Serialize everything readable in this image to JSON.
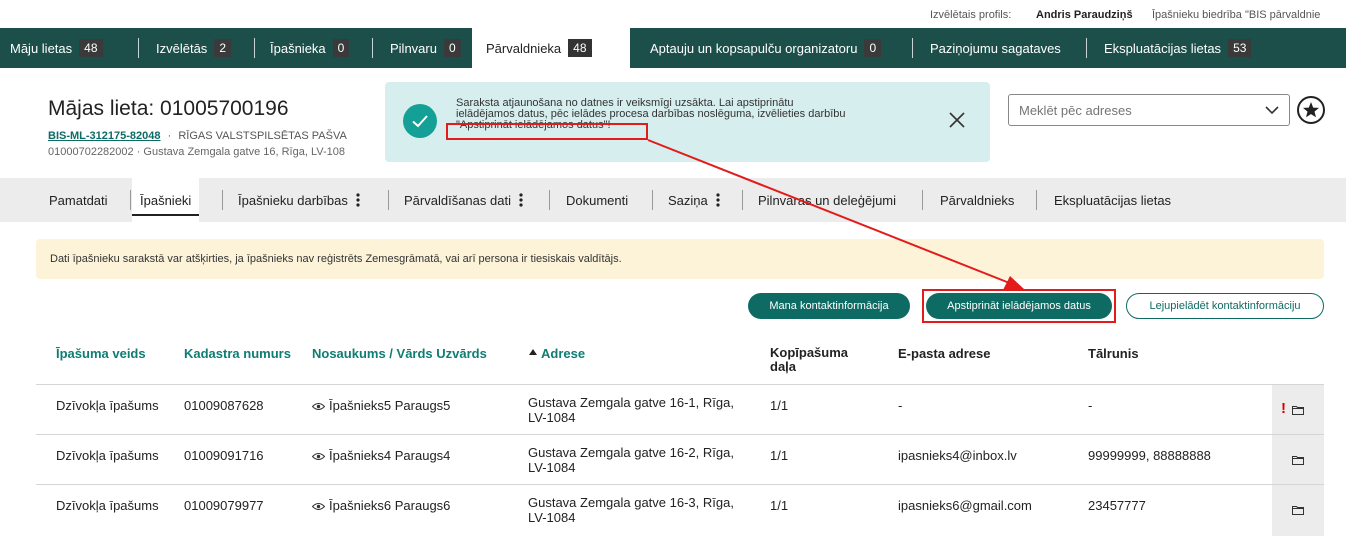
{
  "profile": {
    "label": "Izvēlētais profils:",
    "user": "Andris Paraudziņš",
    "org": "Īpašnieku biedrība \"BIS pārvaldnie"
  },
  "nav": {
    "items": [
      {
        "label": "Māju lietas",
        "count": "48"
      },
      {
        "label": "Izvēlētās",
        "count": "2"
      },
      {
        "label": "Īpašnieka",
        "count": "0"
      },
      {
        "label": "Pilnvaru",
        "count": "0"
      },
      {
        "label": "Pārvaldnieka",
        "count": "48"
      },
      {
        "label": "Aptauju un kopsapulču organizatoru",
        "count": "0"
      },
      {
        "label": "Paziņojumu sagataves",
        "count": ""
      },
      {
        "label": "Ekspluatācijas lietas",
        "count": "53"
      }
    ],
    "active_index": 4
  },
  "header": {
    "title": "Mājas lieta: 01005700196",
    "case_link": "BIS-ML-312175-82048",
    "separator": "·",
    "municipality": "RĪGAS VALSTSPILSĒTAS PAŠVA",
    "cadastre_address": "01000702282002 · Gustava Zemgala gatve 16, Rīga, LV-108"
  },
  "toast": {
    "line1": "Saraksta atjaunošana no datnes ir veiksmīgi uzsākta. Lai apstiprinātu",
    "line2": "ielādējamos datus, pēc ielādes procesa darbības noslēguma, izvēlieties darbību",
    "line3": "\"Apstiprināt ielādējamos datus\"!"
  },
  "search": {
    "placeholder": "Meklēt pēc adreses"
  },
  "tabs": [
    {
      "label": "Pamatdati",
      "menu": false
    },
    {
      "label": "Īpašnieki",
      "menu": false
    },
    {
      "label": "Īpašnieku darbības",
      "menu": true
    },
    {
      "label": "Pārvaldīšanas dati",
      "menu": true
    },
    {
      "label": "Dokumenti",
      "menu": false
    },
    {
      "label": "Saziņa",
      "menu": true
    },
    {
      "label": "Pilnvaras un deleģējumi",
      "menu": false
    },
    {
      "label": "Pārvaldnieks",
      "menu": false
    },
    {
      "label": "Ekspluatācijas lietas",
      "menu": false
    }
  ],
  "notice": "Dati īpašnieku sarakstā var atšķirties, ja īpašnieks nav reģistrēts Zemesgrāmatā, vai arī persona ir tiesiskais valdītājs.",
  "buttons": {
    "my_contacts": "Mana kontaktinformācija",
    "confirm": "Apstiprināt ielādējamos datus",
    "download": "Lejupielādēt kontaktinformāciju"
  },
  "table": {
    "headers": {
      "type": "Īpašuma veids",
      "cadastre": "Kadastra numurs",
      "name": "Nosaukums / Vārds Uzvārds",
      "sort_icon": "sort-ascending-icon",
      "address": "Adrese",
      "share_l1": "Kopīpašuma",
      "share_l2": "daļa",
      "email": "E-pasta adrese",
      "phone": "Tālrunis"
    },
    "rows": [
      {
        "type": "Dzīvokļa īpašums",
        "cadastre": "01009087628",
        "name": "Īpašnieks5 Paraugs5",
        "address_l1": "Gustava Zemgala gatve 16-1, Rīga,",
        "address_l2": "LV-1084",
        "share": "1/1",
        "email": "-",
        "phone": "-",
        "warning": "!"
      },
      {
        "type": "Dzīvokļa īpašums",
        "cadastre": "01009091716",
        "name": "Īpašnieks4 Paraugs4",
        "address_l1": "Gustava Zemgala gatve 16-2, Rīga,",
        "address_l2": "LV-1084",
        "share": "1/1",
        "email": "ipasnieks4@inbox.lv",
        "phone": "99999999, 88888888",
        "warning": ""
      },
      {
        "type": "Dzīvokļa īpašums",
        "cadastre": "01009079977",
        "name": "Īpašnieks6 Paraugs6",
        "address_l1": "Gustava Zemgala gatve 16-3, Rīga,",
        "address_l2": "LV-1084",
        "share": "1/1",
        "email": "ipasnieks6@gmail.com",
        "phone": "23457777",
        "warning": ""
      }
    ]
  },
  "colors": {
    "nav_bg": "#1c4f4a",
    "accent": "#0e6b63",
    "toast_bg": "#d6eeee",
    "notice_bg": "#fdf3d8",
    "annotation": "#e21b1b"
  }
}
